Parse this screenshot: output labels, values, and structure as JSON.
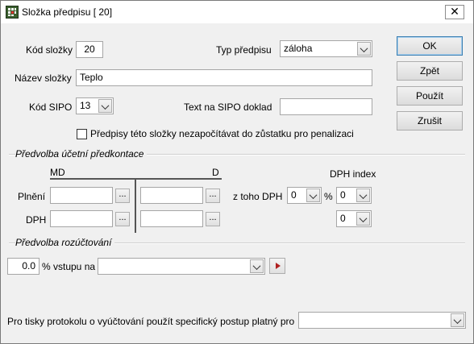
{
  "window": {
    "title": "Složka předpisu  [ 20]"
  },
  "fields": {
    "kod_slozky_label": "Kód složky",
    "kod_slozky_value": "20",
    "typ_predpisu_label": "Typ předpisu",
    "typ_predpisu_value": "záloha",
    "nazev_slozky_label": "Název složky",
    "nazev_slozky_value": "Teplo",
    "kod_sipo_label": "Kód SIPO",
    "kod_sipo_value": "13",
    "text_sipo_label": "Text na SIPO doklad",
    "text_sipo_value": "",
    "checkbox_label": "Předpisy této složky nezapočítávat do zůstatku pro penalizaci"
  },
  "buttons": {
    "ok": "OK",
    "back": "Zpět",
    "apply": "Použít",
    "cancel": "Zrušit"
  },
  "predkontace": {
    "group_title": "Předvolba účetní předkontace",
    "md_label": "MD",
    "d_label": "D",
    "dph_index_label": "DPH index",
    "plneni_label": "Plnění",
    "dph_label": "DPH",
    "z_toho_dph_label": "z toho DPH",
    "z_toho_dph_value": "0",
    "percent_sign": "%",
    "dph_index_1": "0",
    "dph_index_2": "0",
    "dots": "..."
  },
  "rozuctovani": {
    "group_title": "Předvolba rozúčtování",
    "percent_value": "0.0",
    "percent_label": "% vstupu na",
    "target_value": ""
  },
  "footer": {
    "label": "Pro tisky protokolu o vyúčtování použít specifický postup platný pro",
    "value": ""
  },
  "icons": {
    "app": "app-grid-icon",
    "close": "close-icon",
    "dropdown": "chevron-down-icon",
    "arrow": "play-arrow-icon"
  }
}
